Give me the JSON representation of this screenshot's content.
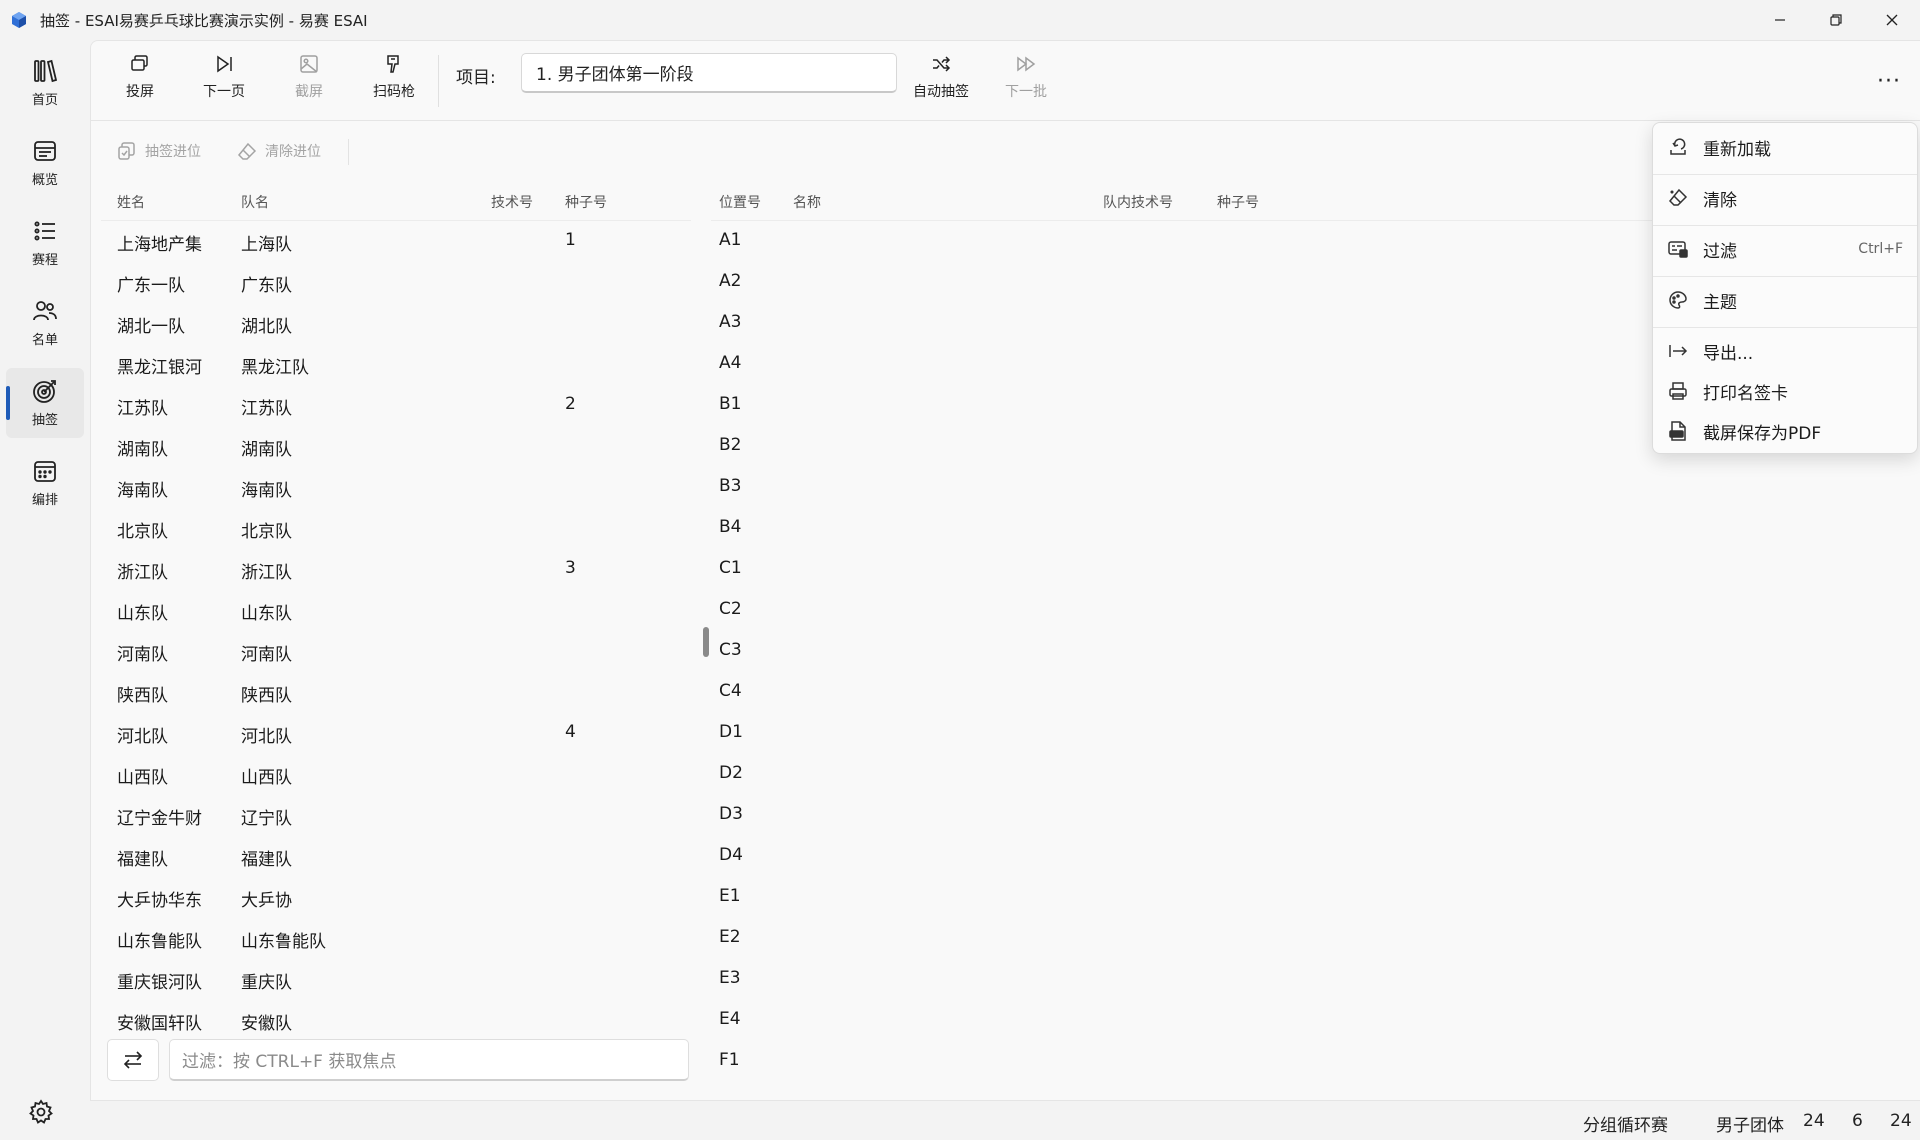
{
  "window": {
    "title": "抽签 - ESAI易赛乒乓球比赛演示实例 - 易赛 ESAI",
    "controls": {
      "minimize": "─",
      "restore": "❐",
      "close": "✕"
    }
  },
  "nav": {
    "items": [
      {
        "label": "首页",
        "icon": "library-icon"
      },
      {
        "label": "概览",
        "icon": "overview-icon"
      },
      {
        "label": "赛程",
        "icon": "list-icon"
      },
      {
        "label": "名单",
        "icon": "people-icon"
      },
      {
        "label": "抽签",
        "icon": "target-icon",
        "active": true
      },
      {
        "label": "编排",
        "icon": "calendar-icon"
      }
    ],
    "settings_icon": "gear-icon"
  },
  "toolbar": {
    "project_screen": "投屏",
    "next_page": "下一页",
    "screenshot": "截屏",
    "scanner": "扫码枪",
    "project_label": "项目:",
    "project_value": "1. 男子团体第一阶段",
    "auto_draw": "自动抽签",
    "next_batch": "下一批",
    "more": "···"
  },
  "subtoolbar": {
    "draw_advance": "抽签进位",
    "clear_advance": "清除进位"
  },
  "left_table": {
    "headers": {
      "name": "姓名",
      "team": "队名",
      "tech": "技术号",
      "seed": "种子号"
    },
    "rows": [
      {
        "name": "上海地产集",
        "team": "上海队",
        "tech": "",
        "seed": "1"
      },
      {
        "name": "广东一队",
        "team": "广东队",
        "tech": "",
        "seed": ""
      },
      {
        "name": "湖北一队",
        "team": "湖北队",
        "tech": "",
        "seed": ""
      },
      {
        "name": "黑龙江银河",
        "team": "黑龙江队",
        "tech": "",
        "seed": ""
      },
      {
        "name": "江苏队",
        "team": "江苏队",
        "tech": "",
        "seed": "2"
      },
      {
        "name": "湖南队",
        "team": "湖南队",
        "tech": "",
        "seed": ""
      },
      {
        "name": "海南队",
        "team": "海南队",
        "tech": "",
        "seed": ""
      },
      {
        "name": "北京队",
        "team": "北京队",
        "tech": "",
        "seed": ""
      },
      {
        "name": "浙江队",
        "team": "浙江队",
        "tech": "",
        "seed": "3"
      },
      {
        "name": "山东队",
        "team": "山东队",
        "tech": "",
        "seed": ""
      },
      {
        "name": "河南队",
        "team": "河南队",
        "tech": "",
        "seed": ""
      },
      {
        "name": "陕西队",
        "team": "陕西队",
        "tech": "",
        "seed": ""
      },
      {
        "name": "河北队",
        "team": "河北队",
        "tech": "",
        "seed": "4"
      },
      {
        "name": "山西队",
        "team": "山西队",
        "tech": "",
        "seed": ""
      },
      {
        "name": "辽宁金牛财",
        "team": "辽宁队",
        "tech": "",
        "seed": ""
      },
      {
        "name": "福建队",
        "team": "福建队",
        "tech": "",
        "seed": ""
      },
      {
        "name": "大乒协华东",
        "team": "大乒协",
        "tech": "",
        "seed": ""
      },
      {
        "name": "山东鲁能队",
        "team": "山东鲁能队",
        "tech": "",
        "seed": ""
      },
      {
        "name": "重庆银河队",
        "team": "重庆队",
        "tech": "",
        "seed": ""
      },
      {
        "name": "安徽国轩队",
        "team": "安徽队",
        "tech": "",
        "seed": ""
      }
    ]
  },
  "right_table": {
    "headers": {
      "position": "位置号",
      "name": "名称",
      "team_tech": "队内技术号",
      "seed": "种子号"
    },
    "rows": [
      {
        "position": "A1"
      },
      {
        "position": "A2"
      },
      {
        "position": "A3"
      },
      {
        "position": "A4"
      },
      {
        "position": "B1"
      },
      {
        "position": "B2"
      },
      {
        "position": "B3"
      },
      {
        "position": "B4"
      },
      {
        "position": "C1"
      },
      {
        "position": "C2"
      },
      {
        "position": "C3"
      },
      {
        "position": "C4"
      },
      {
        "position": "D1"
      },
      {
        "position": "D2"
      },
      {
        "position": "D3"
      },
      {
        "position": "D4"
      },
      {
        "position": "E1"
      },
      {
        "position": "E2"
      },
      {
        "position": "E3"
      },
      {
        "position": "E4"
      },
      {
        "position": "F1"
      }
    ]
  },
  "filter": {
    "placeholder": "过滤：按 CTRL+F 获取焦点"
  },
  "statusbar": {
    "format": "分组循环赛",
    "event": "男子团体",
    "count1": "24",
    "count2": "6",
    "count3": "24"
  },
  "menu": {
    "items": [
      {
        "label": "重新加载",
        "icon": "reload-icon",
        "shortcut": ""
      },
      {
        "label": "清除",
        "icon": "eraser-icon",
        "shortcut": ""
      },
      {
        "label": "过滤",
        "icon": "filter-icon",
        "shortcut": "Ctrl+F"
      },
      {
        "label": "主题",
        "icon": "palette-icon",
        "shortcut": ""
      },
      {
        "label": "导出...",
        "icon": "export-icon",
        "shortcut": ""
      },
      {
        "label": "打印名签卡",
        "icon": "print-icon",
        "shortcut": ""
      },
      {
        "label": "截屏保存为PDF",
        "icon": "pdf-icon",
        "shortcut": ""
      }
    ]
  }
}
